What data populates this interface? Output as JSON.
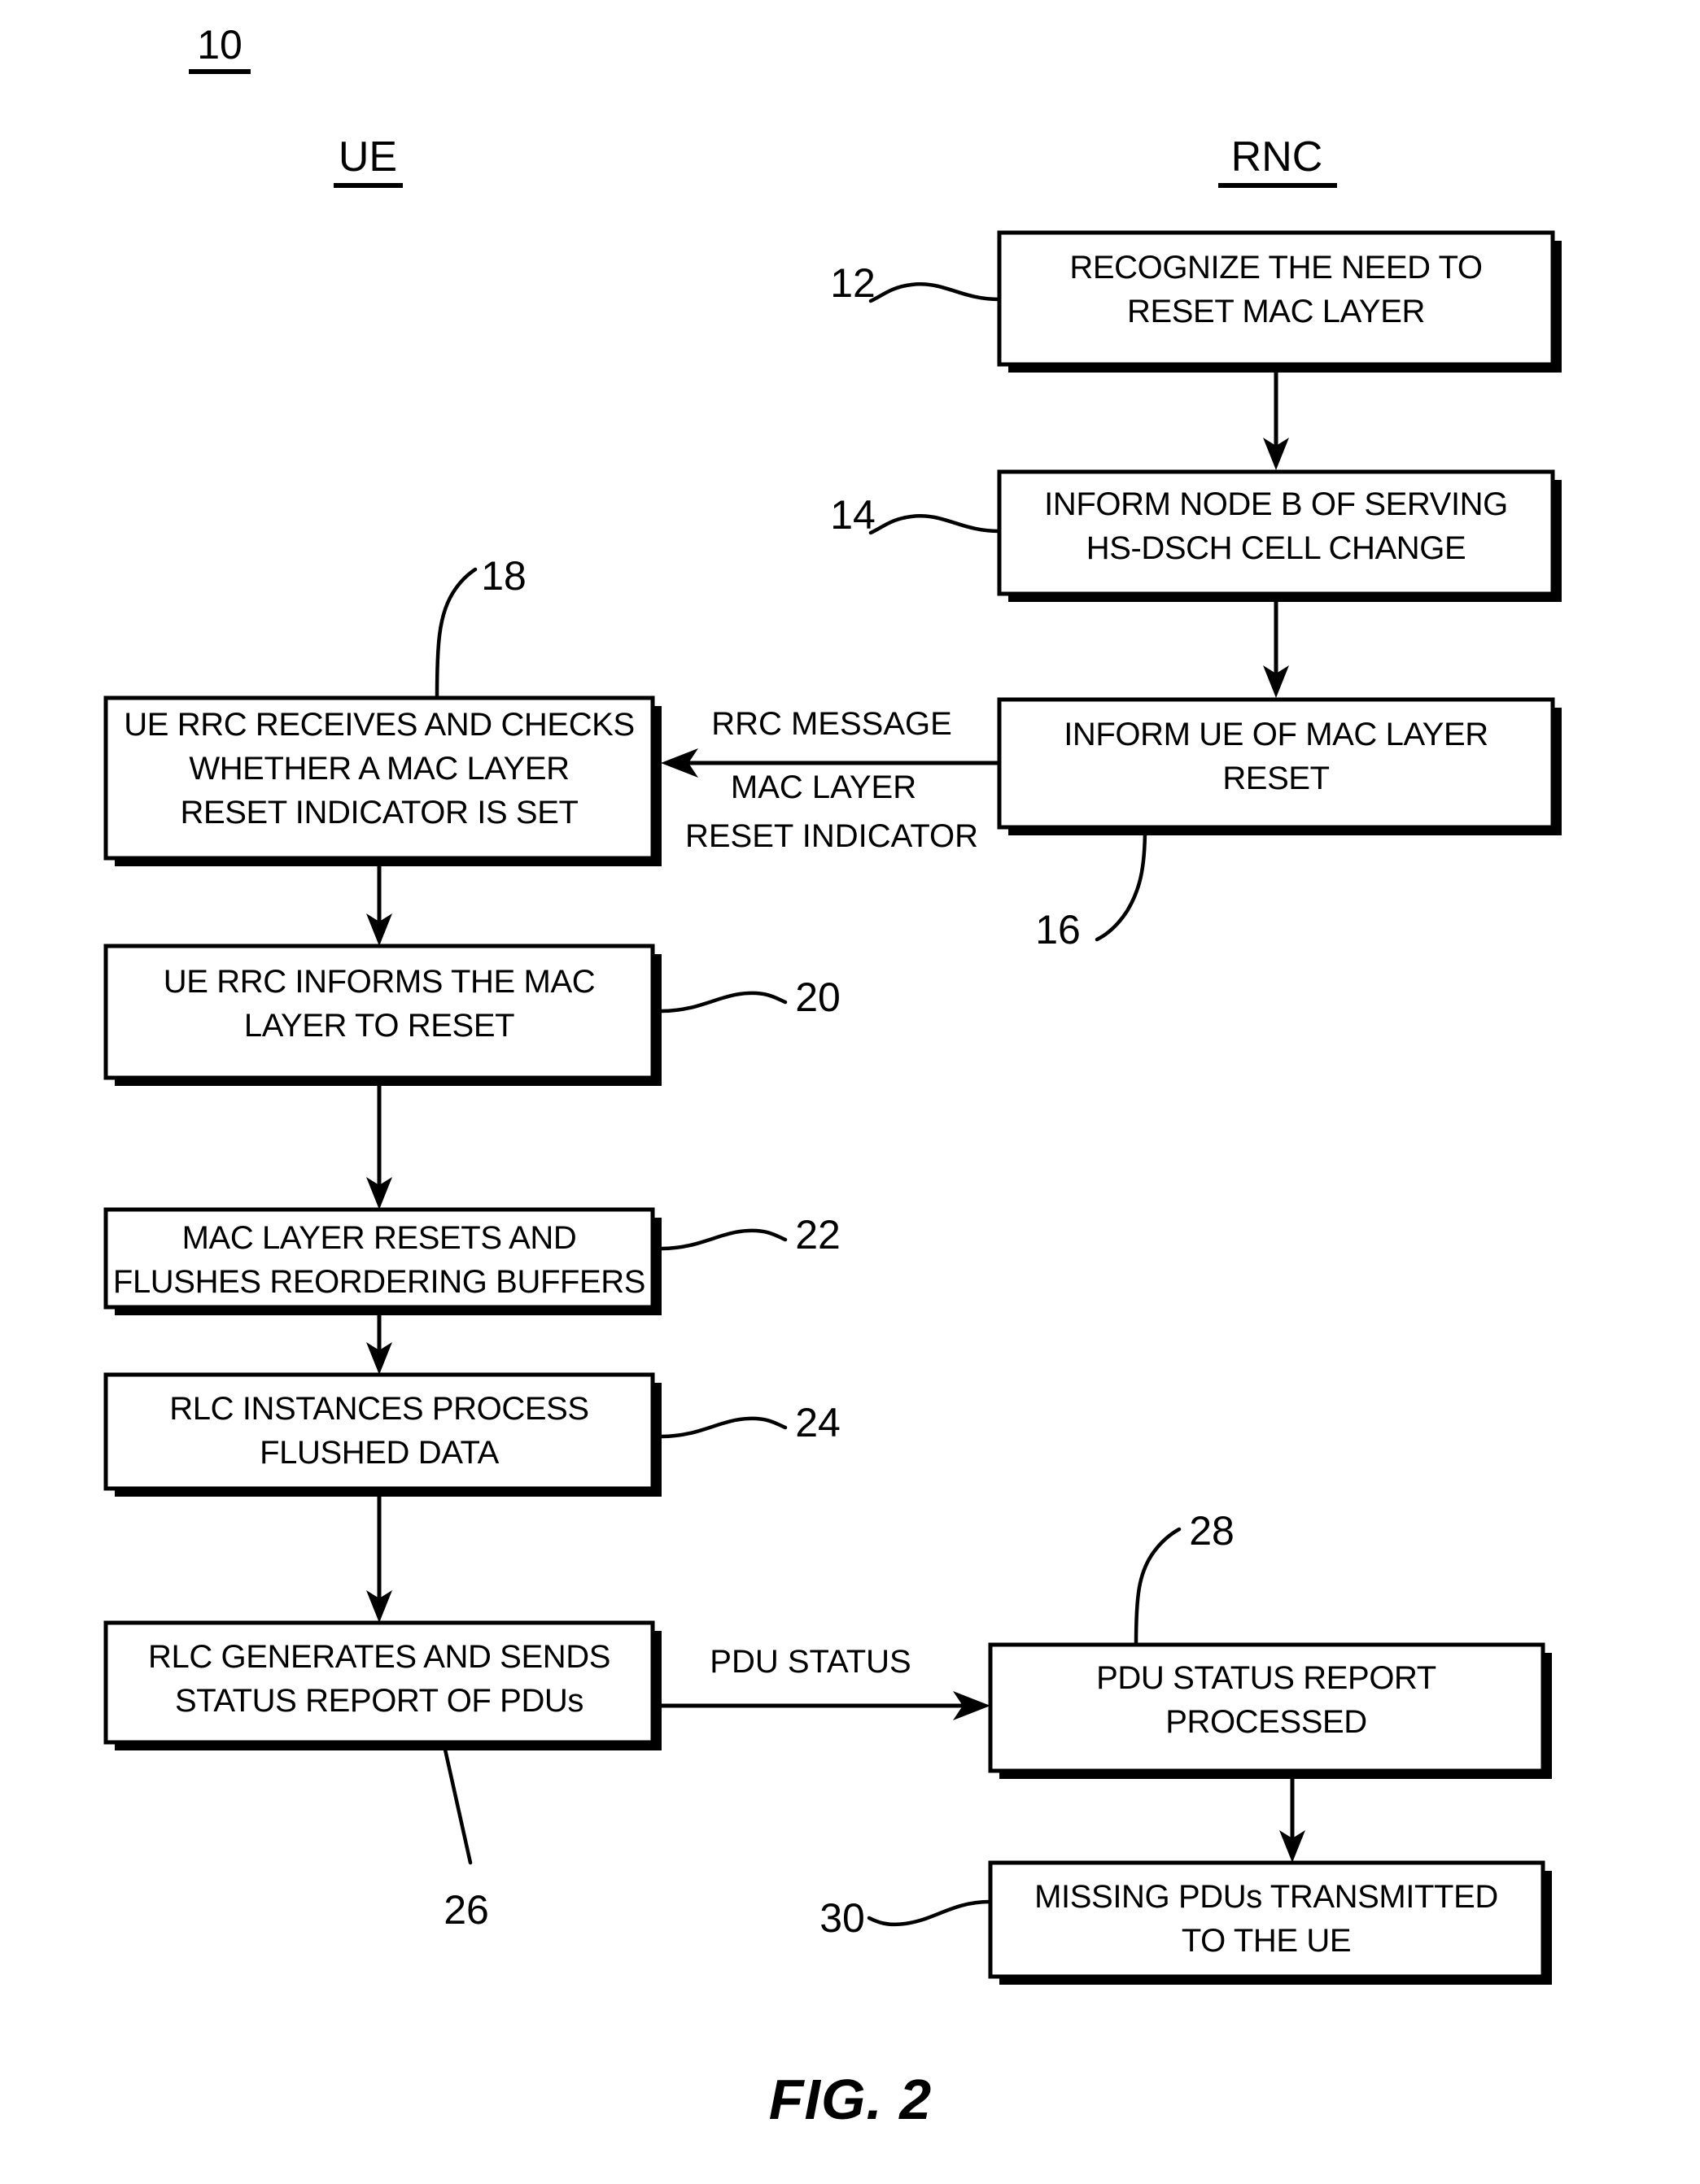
{
  "figure": {
    "figure_number_label": "10",
    "caption": "FIG. 2",
    "columns": [
      {
        "id": "ue",
        "label": "UE"
      },
      {
        "id": "rnc",
        "label": "RNC"
      }
    ]
  },
  "boxes": [
    {
      "ref": "12",
      "column": "rnc",
      "lines": [
        "RECOGNIZE THE NEED TO",
        "RESET MAC LAYER"
      ]
    },
    {
      "ref": "14",
      "column": "rnc",
      "lines": [
        "INFORM NODE B OF SERVING",
        "HS-DSCH CELL CHANGE"
      ]
    },
    {
      "ref": "16",
      "column": "rnc",
      "lines": [
        "INFORM UE OF MAC LAYER",
        "RESET"
      ]
    },
    {
      "ref": "18",
      "column": "ue",
      "lines": [
        "UE RRC RECEIVES AND CHECKS",
        "WHETHER A MAC LAYER",
        "RESET INDICATOR IS SET"
      ]
    },
    {
      "ref": "20",
      "column": "ue",
      "lines": [
        "UE RRC INFORMS THE MAC",
        "LAYER TO RESET"
      ]
    },
    {
      "ref": "22",
      "column": "ue",
      "lines": [
        "MAC LAYER RESETS AND",
        "FLUSHES REORDERING BUFFERS"
      ]
    },
    {
      "ref": "24",
      "column": "ue",
      "lines": [
        "RLC INSTANCES PROCESS",
        "FLUSHED DATA"
      ]
    },
    {
      "ref": "26",
      "column": "ue",
      "lines": [
        "RLC GENERATES AND SENDS",
        "STATUS REPORT OF PDUs"
      ]
    },
    {
      "ref": "28",
      "column": "rnc",
      "lines": [
        "PDU STATUS REPORT",
        "PROCESSED"
      ]
    },
    {
      "ref": "30",
      "column": "rnc",
      "lines": [
        "MISSING PDUs TRANSMITTED",
        "TO THE UE"
      ]
    }
  ],
  "edge_labels": {
    "rrc_message": [
      "RRC MESSAGE",
      "MAC LAYER",
      "RESET INDICATOR"
    ],
    "pdu_status": "PDU STATUS"
  },
  "colors": {
    "ink": "#000000",
    "paper": "#ffffff"
  }
}
